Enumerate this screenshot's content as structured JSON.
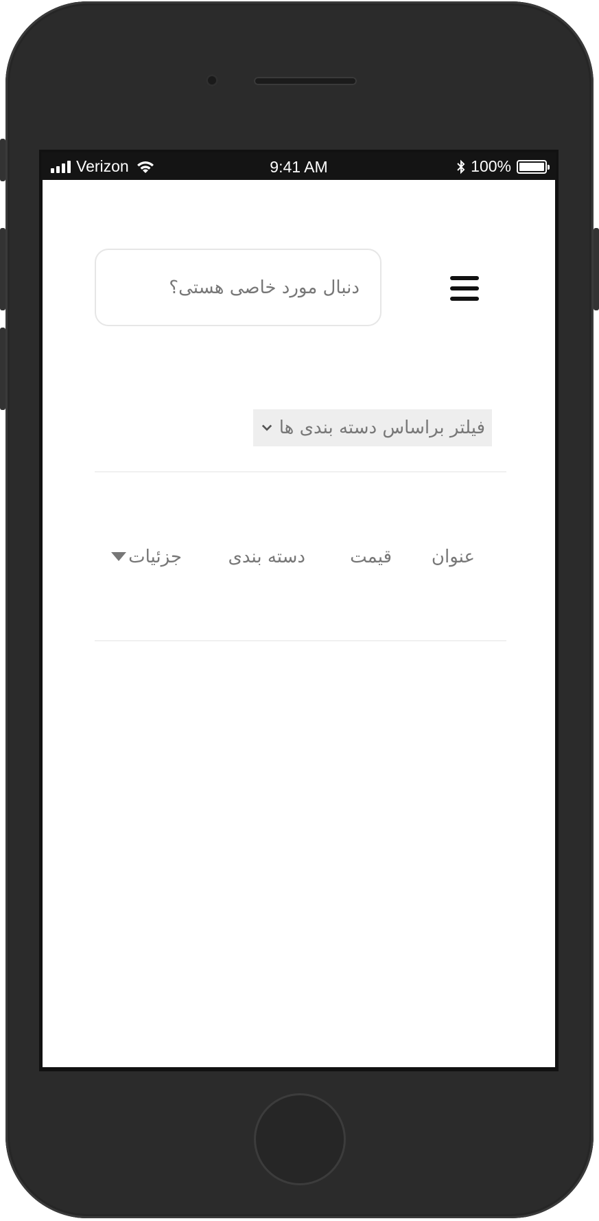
{
  "status_bar": {
    "carrier": "Verizon",
    "time": "9:41 AM",
    "battery": "100%",
    "battery_level": 1.0
  },
  "header": {
    "search_placeholder": "دنبال مورد خاصی هستی؟",
    "menu_icon": "hamburger-menu-icon"
  },
  "filter": {
    "label": "فیلتر براساس دسته بندی ها",
    "chevron_icon": "chevron-down-icon"
  },
  "table": {
    "columns": [
      "عنوان",
      "قیمت",
      "دسته بندی",
      "جزئیات"
    ],
    "sort_icon": "caret-down-icon"
  },
  "colors": {
    "text_muted": "#777777",
    "filter_bg": "#eeeeee",
    "divider": "#f0f0f0",
    "device_body": "#2b2b2b"
  }
}
